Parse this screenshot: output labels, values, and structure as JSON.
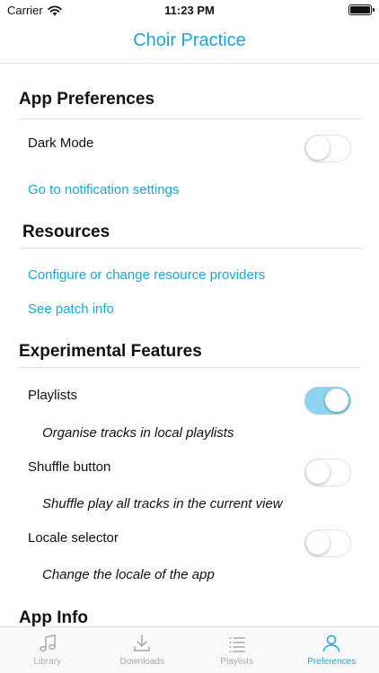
{
  "status_bar": {
    "carrier": "Carrier",
    "time": "11:23 PM"
  },
  "nav": {
    "title": "Choir Practice"
  },
  "sections": {
    "app_preferences": {
      "title": "App Preferences",
      "dark_mode_label": "Dark Mode",
      "dark_mode_on": false,
      "notification_link": "Go to notification settings"
    },
    "resources": {
      "title": "Resources",
      "configure_link": "Configure or change resource providers",
      "patch_link": "See patch info"
    },
    "experimental": {
      "title": "Experimental Features",
      "playlists_label": "Playlists",
      "playlists_on": true,
      "playlists_desc": "Organise tracks in local playlists",
      "shuffle_label": "Shuffle button",
      "shuffle_on": false,
      "shuffle_desc": "Shuffle play all tracks in the current view",
      "locale_label": "Locale selector",
      "locale_on": false,
      "locale_desc": "Change the locale of the app"
    },
    "app_info": {
      "title": "App Info"
    }
  },
  "tabs": [
    {
      "label": "Library",
      "icon": "music-note-icon",
      "active": false
    },
    {
      "label": "Downloads",
      "icon": "download-icon",
      "active": false
    },
    {
      "label": "Playlists",
      "icon": "list-icon",
      "active": false
    },
    {
      "label": "Preferences",
      "icon": "person-icon",
      "active": true
    }
  ],
  "colors": {
    "accent": "#1aa6d4",
    "toggle_on": "#8fd3ee",
    "tab_inactive": "#a8a8a8"
  }
}
